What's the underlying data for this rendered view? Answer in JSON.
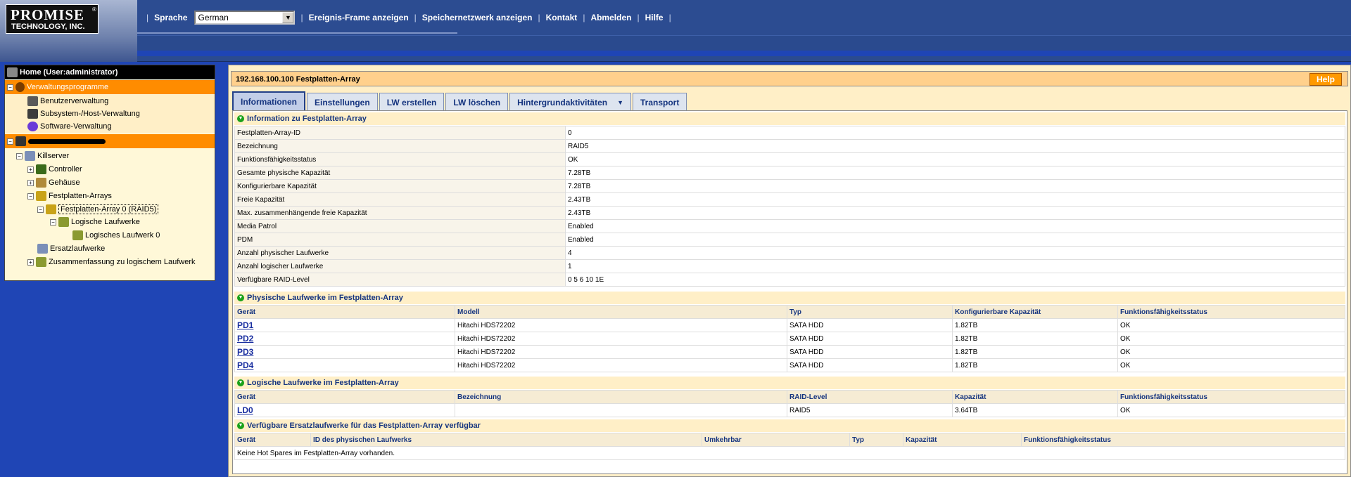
{
  "header": {
    "logo_main": "PROMISE",
    "logo_sub": "TECHNOLOGY, INC.",
    "logo_reg": "®",
    "language_label": "Sprache",
    "language_value": "German",
    "nav": [
      "Ereignis-Frame anzeigen",
      "Speichernetzwerk anzeigen",
      "Kontakt",
      "Abmelden",
      "Hilfe"
    ]
  },
  "tree": {
    "home": "Home (User:administrator)",
    "admin_tools": "Verwaltungsprogramme",
    "tools": [
      "Benutzerverwaltung",
      "Subsystem-/Host-Verwaltung",
      "Software-Verwaltung"
    ],
    "host_label": "",
    "server": "Killserver",
    "controller": "Controller",
    "enclosure": "Gehäuse",
    "arrays": "Festplatten-Arrays",
    "array0": "Festplatten-Array 0 (RAID5)",
    "logical_drives": "Logische Laufwerke",
    "logical_drive0": "Logisches Laufwerk 0",
    "spares": "Ersatzlaufwerke",
    "ld_summary": "Zusammenfassung zu logischem Laufwerk"
  },
  "content": {
    "title": "192.168.100.100 Festplatten-Array",
    "help": "Help",
    "tabs": [
      "Informationen",
      "Einstellungen",
      "LW erstellen",
      "LW löschen",
      "Hintergrundaktivitäten",
      "Transport"
    ],
    "active_tab": "Informationen",
    "info_section": "Information zu Festplatten-Array",
    "info_rows": [
      [
        "Festplatten-Array-ID",
        "0"
      ],
      [
        "Bezeichnung",
        "RAID5"
      ],
      [
        "Funktionsfähigkeitsstatus",
        "OK"
      ],
      [
        "Gesamte physische Kapazität",
        "7.28TB"
      ],
      [
        "Konfigurierbare Kapazität",
        "7.28TB"
      ],
      [
        "Freie Kapazität",
        "2.43TB"
      ],
      [
        "Max. zusammenhängende freie Kapazität",
        "2.43TB"
      ],
      [
        "Media Patrol",
        "Enabled"
      ],
      [
        "PDM",
        "Enabled"
      ],
      [
        "Anzahl physischer Laufwerke",
        "4"
      ],
      [
        "Anzahl logischer Laufwerke",
        "1"
      ],
      [
        "Verfügbare RAID-Level",
        "0 5 6 10 1E"
      ]
    ],
    "pd_section": "Physische Laufwerke im Festplatten-Array",
    "pd_headers": [
      "Gerät",
      "Modell",
      "Typ",
      "Konfigurierbare Kapazität",
      "Funktionsfähigkeitsstatus"
    ],
    "pd_rows": [
      [
        "PD1",
        "Hitachi HDS72202",
        "SATA HDD",
        "1.82TB",
        "OK"
      ],
      [
        "PD2",
        "Hitachi HDS72202",
        "SATA HDD",
        "1.82TB",
        "OK"
      ],
      [
        "PD3",
        "Hitachi HDS72202",
        "SATA HDD",
        "1.82TB",
        "OK"
      ],
      [
        "PD4",
        "Hitachi HDS72202",
        "SATA HDD",
        "1.82TB",
        "OK"
      ]
    ],
    "ld_section": "Logische Laufwerke im Festplatten-Array",
    "ld_headers": [
      "Gerät",
      "Bezeichnung",
      "RAID-Level",
      "Kapazität",
      "Funktionsfähigkeitsstatus"
    ],
    "ld_rows": [
      [
        "LD0",
        "",
        "RAID5",
        "3.64TB",
        "OK"
      ]
    ],
    "spare_section": "Verfügbare Ersatzlaufwerke für das Festplatten-Array verfügbar",
    "spare_headers": [
      "Gerät",
      "ID des physischen Laufwerks",
      "Umkehrbar",
      "Typ",
      "Kapazität",
      "Funktionsfähigkeitsstatus"
    ],
    "spare_empty": "Keine Hot Spares im Festplatten-Array vorhanden."
  }
}
